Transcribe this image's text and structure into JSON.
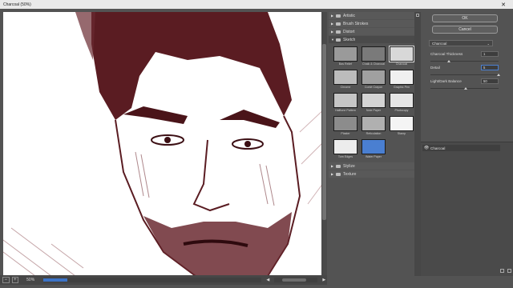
{
  "window": {
    "title": "Charcoal (50%)",
    "close_glyph": "✕"
  },
  "status": {
    "zoom": "50%",
    "minus_glyph": "−",
    "plus_glyph": "+",
    "left_arrow": "◀",
    "right_arrow": "▶"
  },
  "gallery": {
    "folders_top": [
      {
        "label": "Artistic"
      },
      {
        "label": "Brush Strokes"
      },
      {
        "label": "Distort"
      }
    ],
    "open_folder": "Sketch",
    "thumbnails": [
      {
        "label": "Bas Relief",
        "bg": "#9a9a9a"
      },
      {
        "label": "Chalk & Charcoal",
        "bg": "#7a7a7a"
      },
      {
        "label": "Charcoal",
        "bg": "#d8d8d8",
        "selected": true
      },
      {
        "label": "Chrome",
        "bg": "#bcbcbc"
      },
      {
        "label": "Conté Crayon",
        "bg": "#a0a0a0"
      },
      {
        "label": "Graphic Pen",
        "bg": "#f0f0f0"
      },
      {
        "label": "Halftone Pattern",
        "bg": "#c6c6c6"
      },
      {
        "label": "Note Paper",
        "bg": "#d4d4d4"
      },
      {
        "label": "Photocopy",
        "bg": "#e6e6e6"
      },
      {
        "label": "Plaster",
        "bg": "#8c8c8c"
      },
      {
        "label": "Reticulation",
        "bg": "#b0b0b0"
      },
      {
        "label": "Stamp",
        "bg": "#f4f4f4"
      },
      {
        "label": "Torn Edges",
        "bg": "#ececec"
      },
      {
        "label": "Water Paper",
        "bg": "#4a7fd1"
      }
    ],
    "folders_bottom": [
      {
        "label": "Stylize"
      },
      {
        "label": "Texture"
      }
    ]
  },
  "options": {
    "ok_label": "OK",
    "cancel_label": "Cancel",
    "filter_select": "Charcoal",
    "params": [
      {
        "label": "Charcoal Thickness",
        "value": "1",
        "level": 0.25
      },
      {
        "label": "Detail",
        "value": "5",
        "level": 1.0,
        "active": true
      },
      {
        "label": "Light/Dark Balance",
        "value": "50",
        "level": 0.5
      }
    ]
  },
  "layers": {
    "items": [
      {
        "label": "Charcoal"
      }
    ]
  }
}
